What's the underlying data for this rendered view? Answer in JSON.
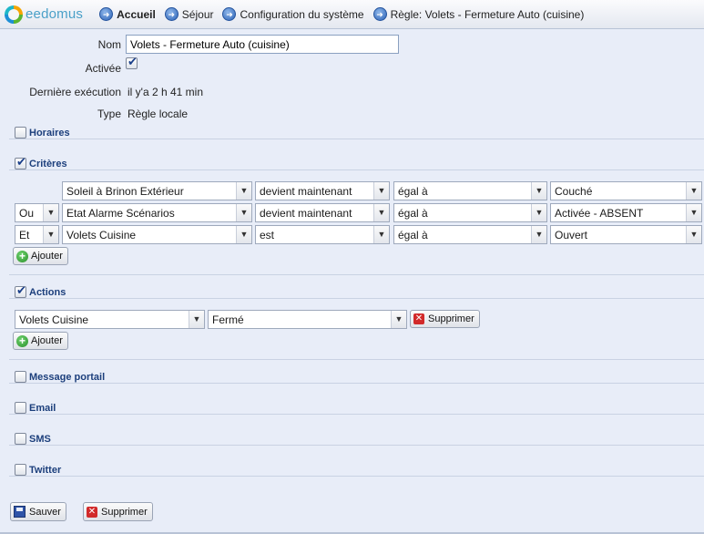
{
  "brand": "eedomus",
  "breadcrumbs": [
    {
      "label": "Accueil",
      "bold": true
    },
    {
      "label": "Séjour"
    },
    {
      "label": "Configuration du système"
    },
    {
      "label": "Règle: Volets - Fermeture Auto (cuisine)"
    }
  ],
  "form": {
    "name_label": "Nom",
    "name_value": "Volets - Fermeture Auto (cuisine)",
    "active_label": "Activée",
    "active_checked": true,
    "last_run_label": "Dernière exécution",
    "last_run_value": "il y'a 2 h 41 min",
    "type_label": "Type",
    "type_value": "Règle locale"
  },
  "sections": {
    "horaires": {
      "title": "Horaires",
      "checked": false
    },
    "criteres": {
      "title": "Critères",
      "checked": true
    },
    "actions": {
      "title": "Actions",
      "checked": true
    },
    "message": {
      "title": "Message portail",
      "checked": false
    },
    "email": {
      "title": "Email",
      "checked": false
    },
    "sms": {
      "title": "SMS",
      "checked": false
    },
    "twitter": {
      "title": "Twitter",
      "checked": false
    }
  },
  "criteria": [
    {
      "conj": "",
      "device": "Soleil à Brinon Extérieur",
      "condition": "devient maintenant",
      "operator": "égal à",
      "value": "Couché"
    },
    {
      "conj": "Ou",
      "device": "Etat Alarme Scénarios",
      "condition": "devient maintenant",
      "operator": "égal à",
      "value": "Activée - ABSENT"
    },
    {
      "conj": "Et",
      "device": "Volets Cuisine",
      "condition": "est",
      "operator": "égal à",
      "value": "Ouvert"
    }
  ],
  "actions": [
    {
      "device": "Volets Cuisine",
      "value": "Fermé",
      "delete_label": "Supprimer"
    }
  ],
  "buttons": {
    "add_label": "Ajouter",
    "save_label": "Sauver",
    "delete_label": "Supprimer"
  }
}
